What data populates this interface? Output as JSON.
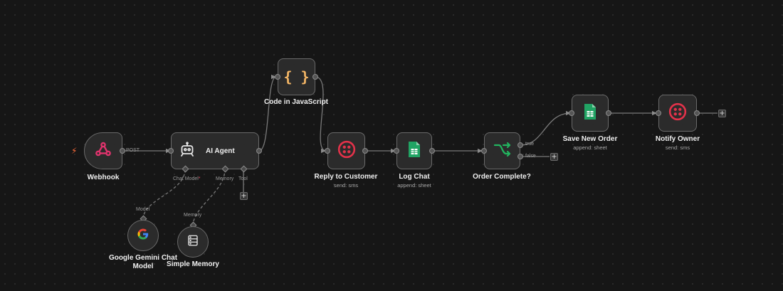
{
  "nodes": {
    "webhook": {
      "label": "Webhook",
      "output_label": "POST"
    },
    "ai_agent": {
      "label": "AI Agent",
      "port_chat_model": "Chat Model",
      "port_chat_model_required": "*",
      "port_memory": "Memory",
      "port_tool": "Tool"
    },
    "code_js": {
      "label": "Code in JavaScript",
      "icon_text": "{ }"
    },
    "reply_customer": {
      "label": "Reply to Customer",
      "sublabel": "send: sms"
    },
    "log_chat": {
      "label": "Log Chat",
      "sublabel": "append: sheet"
    },
    "order_complete": {
      "label": "Order Complete?",
      "true_label": "true",
      "false_label": "false"
    },
    "save_order": {
      "label": "Save New Order",
      "sublabel": "append: sheet"
    },
    "notify_owner": {
      "label": "Notify Owner",
      "sublabel": "send: sms"
    },
    "gemini": {
      "label_line1": "Google Gemini Chat",
      "label_line2": "Model",
      "port_label": "Model"
    },
    "memory": {
      "label": "Simple Memory",
      "port_label": "Memory"
    }
  },
  "add_symbol": "+",
  "icons": {
    "webhook": "webhook-icon",
    "ai_agent": "robot-icon",
    "code": "code-braces-icon",
    "twilio": "twilio-icon",
    "sheets": "google-sheets-icon",
    "if": "branch-icon",
    "gemini": "google-g-icon",
    "memory": "database-icon",
    "trigger": "lightning-bolt-icon"
  },
  "colors": {
    "canvas": "#161616",
    "node_bg": "#2b2b2b",
    "node_border": "#6a6a6a",
    "webhook": "#e0336d",
    "twilio": "#e3324a",
    "sheets": "#21a464",
    "if": "#22b55f",
    "code": "#f5b766",
    "trigger": "#ff6d3a"
  }
}
